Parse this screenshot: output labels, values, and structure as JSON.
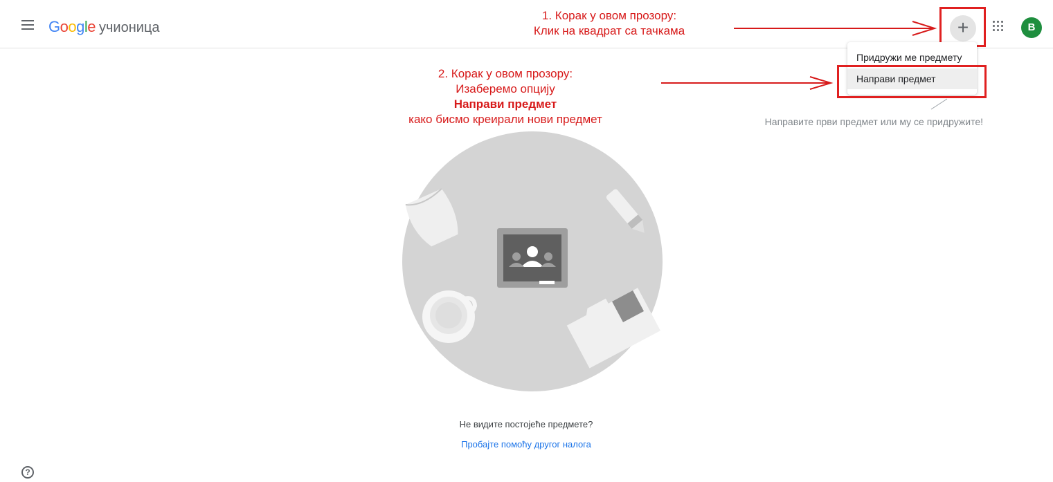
{
  "header": {
    "logo_letters": [
      "G",
      "o",
      "o",
      "g",
      "l",
      "e"
    ],
    "product": "учионица",
    "plus_symbol": "+",
    "avatar_letter": "B",
    "icons": [
      "menu-icon",
      "plus-icon",
      "apps-grid-icon"
    ]
  },
  "dropdown": {
    "items": [
      {
        "label": "Придружи ме предмету"
      },
      {
        "label": "Направи предмет"
      }
    ]
  },
  "hint_text": "Направите први предмет или му се придружите!",
  "annotations": {
    "step1": {
      "line1": "1. Корак у овом прозору:",
      "line2": "Клик на квадрат са тачкама"
    },
    "step2": {
      "line1": "2. Корак у овом прозору:",
      "line2": "Изаберемо опцију",
      "line3": "Направи предмет",
      "line4": "како бисмо креирали нови предмет"
    }
  },
  "empty_state": {
    "question": "Не видите постојеће предмете?",
    "link": "Пробајте помоћу другог налога"
  },
  "help_symbol": "?",
  "colors": {
    "annotation_red": "#d71a1a",
    "link_blue": "#1a73e8",
    "avatar_green": "#1e8e3e",
    "illustration_gray": "#d4d4d4"
  }
}
